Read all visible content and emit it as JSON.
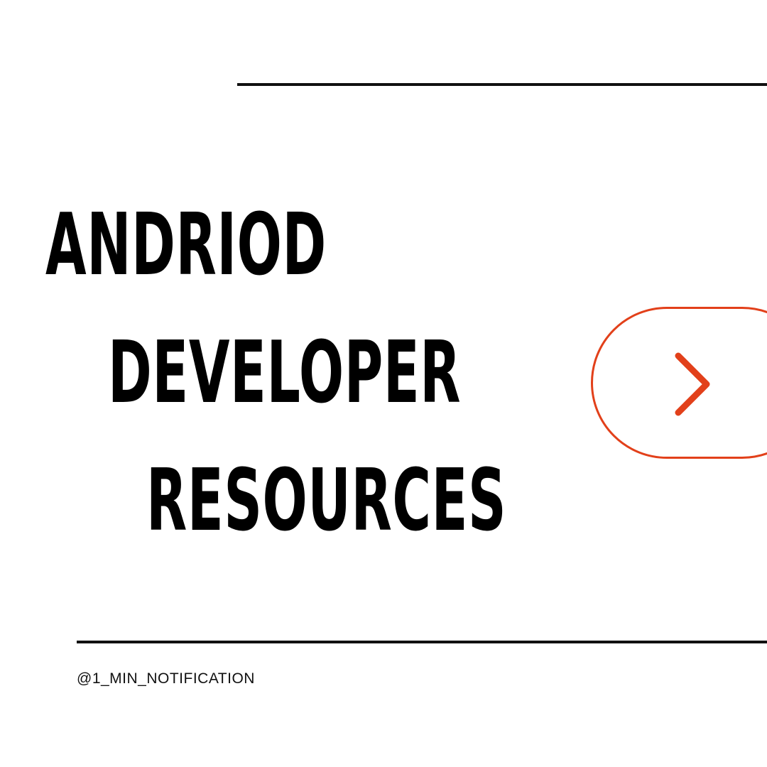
{
  "title": {
    "line1": "ANDRIOD",
    "line2": "DEVELOPER",
    "line3": "RESOURCES"
  },
  "next_button": {
    "icon": "chevron-right-icon"
  },
  "footer": {
    "handle": "@1_MIN_NOTIFICATION"
  },
  "colors": {
    "accent": "#e2401a",
    "text": "#000000",
    "background": "#ffffff"
  }
}
